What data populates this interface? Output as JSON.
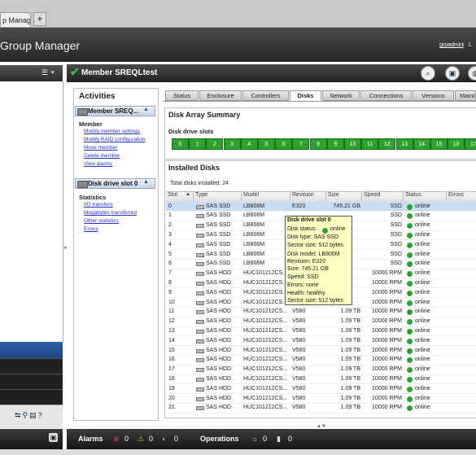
{
  "browser": {
    "tab_title": "p Manager",
    "new_tab": "+"
  },
  "header": {
    "title": "Group Manager",
    "user": "grpadmin",
    "separator": "|",
    "trailing": "L"
  },
  "left_panel": {
    "menu_icon": "list-icon",
    "menu_dropdown": "▾"
  },
  "member": {
    "title": "Member SREQLtest",
    "status_icon": "check-icon"
  },
  "header_buttons": [
    {
      "icon": "search-icon",
      "glyph": "⌕"
    },
    {
      "icon": "save-icon",
      "glyph": "▣"
    },
    {
      "icon": "globe-icon",
      "glyph": "◍"
    }
  ],
  "activities": {
    "title": "Activities",
    "member_section": "Member SREQ...",
    "member_heading": "Member",
    "member_links": [
      "Modify member settings",
      "Modify RAID configuration",
      "Move member",
      "Delete member",
      "View alarms"
    ],
    "slot_section": "Disk drive slot 0",
    "stats_heading": "Statistics",
    "stats_links": [
      "I/O transfers",
      "Megabytes transferred",
      "Other statistics",
      "Errors"
    ]
  },
  "tabs": [
    "Status",
    "Enclosure",
    "Controllers",
    "Disks",
    "Network",
    "Connections",
    "Versions",
    "Maint"
  ],
  "active_tab": "Disks",
  "disk_array": {
    "title": "Disk Array Summary",
    "slots_label": "Disk drive slots",
    "slots": [
      "0",
      "1",
      "2",
      "3",
      "4",
      "5",
      "6",
      "7",
      "8",
      "9",
      "10",
      "11",
      "12",
      "13",
      "14",
      "15",
      "16",
      "17",
      "18"
    ]
  },
  "installed": {
    "title": "Installed Disks",
    "total": "Total disks installed: 24",
    "columns": [
      "Slot",
      "Type",
      "Model",
      "Revision",
      "Size",
      "Speed",
      "Status",
      "Errors"
    ],
    "rows": [
      {
        "slot": "0",
        "type": "SAS SSD",
        "model": "LB806M",
        "rev": "E320",
        "size": "745.21 GB",
        "speed": "SSD",
        "status": "online"
      },
      {
        "slot": "1",
        "type": "SAS SSD",
        "model": "LB806M",
        "rev": "",
        "size": "",
        "speed": "SSD",
        "status": "online"
      },
      {
        "slot": "2",
        "type": "SAS SSD",
        "model": "LB806M",
        "rev": "",
        "size": "",
        "speed": "SSD",
        "status": "online"
      },
      {
        "slot": "3",
        "type": "SAS SSD",
        "model": "LB806M",
        "rev": "",
        "size": "",
        "speed": "SSD",
        "status": "online"
      },
      {
        "slot": "4",
        "type": "SAS SSD",
        "model": "LB806M",
        "rev": "",
        "size": "",
        "speed": "SSD",
        "status": "online"
      },
      {
        "slot": "5",
        "type": "SAS SSD",
        "model": "LB806M",
        "rev": "",
        "size": "",
        "speed": "SSD",
        "status": "online"
      },
      {
        "slot": "6",
        "type": "SAS SSD",
        "model": "LB806M",
        "rev": "",
        "size": "",
        "speed": "SSD",
        "status": "online"
      },
      {
        "slot": "7",
        "type": "SAS HDD",
        "model": "HUC101212CS...",
        "rev": "",
        "size": "",
        "speed": "10000 RPM",
        "status": "online"
      },
      {
        "slot": "8",
        "type": "SAS HDD",
        "model": "HUC101212CS...",
        "rev": "",
        "size": "",
        "speed": "10000 RPM",
        "status": "online"
      },
      {
        "slot": "9",
        "type": "SAS HDD",
        "model": "HUC101212CS...",
        "rev": "",
        "size": "",
        "speed": "10000 RPM",
        "status": "online"
      },
      {
        "slot": "10",
        "type": "SAS HDD",
        "model": "HUC101212CS...",
        "rev": "",
        "size": "",
        "speed": "10000 RPM",
        "status": "online"
      },
      {
        "slot": "11",
        "type": "SAS HDD",
        "model": "HUC101212CS...",
        "rev": "V580",
        "size": "1.09 TB",
        "speed": "10000 RPM",
        "status": "online"
      },
      {
        "slot": "12",
        "type": "SAS HDD",
        "model": "HUC101212CS...",
        "rev": "V580",
        "size": "1.09 TB",
        "speed": "10000 RPM",
        "status": "online"
      },
      {
        "slot": "13",
        "type": "SAS HDD",
        "model": "HUC101212CS...",
        "rev": "V580",
        "size": "1.09 TB",
        "speed": "10000 RPM",
        "status": "online"
      },
      {
        "slot": "14",
        "type": "SAS HDD",
        "model": "HUC101212CS...",
        "rev": "V580",
        "size": "1.09 TB",
        "speed": "10000 RPM",
        "status": "online"
      },
      {
        "slot": "15",
        "type": "SAS HDD",
        "model": "HUC101212CS...",
        "rev": "V580",
        "size": "1.09 TB",
        "speed": "10000 RPM",
        "status": "online"
      },
      {
        "slot": "16",
        "type": "SAS HDD",
        "model": "HUC101212CS...",
        "rev": "V580",
        "size": "1.09 TB",
        "speed": "10000 RPM",
        "status": "online"
      },
      {
        "slot": "17",
        "type": "SAS HDD",
        "model": "HUC101212CS...",
        "rev": "V580",
        "size": "1.09 TB",
        "speed": "10000 RPM",
        "status": "online"
      },
      {
        "slot": "18",
        "type": "SAS HDD",
        "model": "HUC101212CS...",
        "rev": "V580",
        "size": "1.09 TB",
        "speed": "10000 RPM",
        "status": "online"
      },
      {
        "slot": "19",
        "type": "SAS HDD",
        "model": "HUC101212CS...",
        "rev": "V580",
        "size": "1.09 TB",
        "speed": "10000 RPM",
        "status": "online"
      },
      {
        "slot": "20",
        "type": "SAS HDD",
        "model": "HUC101212CS...",
        "rev": "V580",
        "size": "1.09 TB",
        "speed": "10000 RPM",
        "status": "online"
      },
      {
        "slot": "21",
        "type": "SAS HDD",
        "model": "HUC101212CS...",
        "rev": "V580",
        "size": "1.09 TB",
        "speed": "10000 RPM",
        "status": "online"
      }
    ]
  },
  "tooltip": {
    "title": "Disk drive slot 0",
    "lines": [
      "Disk status:",
      "Disk type:  SAS SSD",
      "Sector size:  512 bytes",
      "Disk model:  LB806M",
      "Revision:  E320",
      "Size:  745.21 GB",
      "Speed:  SSD",
      "Errors:  none",
      "Health:  healthy",
      "Sector size:  512 bytes"
    ],
    "status_value": "online"
  },
  "statusbar": {
    "alarms_label": "Alarms",
    "critical": "0",
    "warning": "0",
    "info": "0",
    "operations_label": "Operations",
    "ops_in_progress": "0",
    "ops_other": "0"
  },
  "colors": {
    "online": "#2ea12e",
    "tab_active": "#ffffff",
    "link": "#2335c6"
  }
}
